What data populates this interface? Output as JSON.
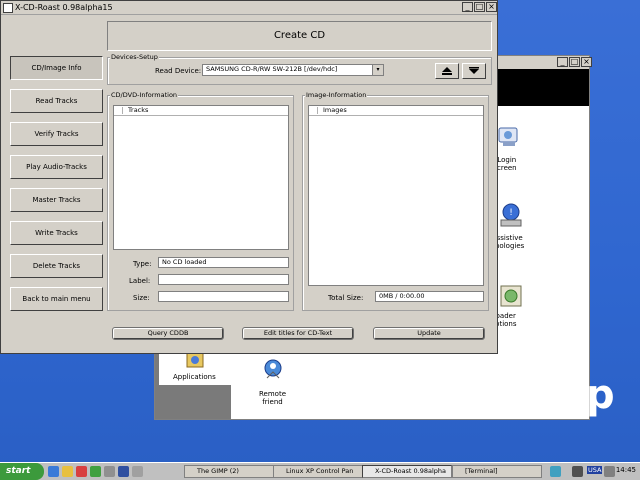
{
  "main_window": {
    "title": "X-CD-Roast 0.98alpha15",
    "header_title": "Create CD",
    "sidebar": [
      {
        "label": "CD/Image Info",
        "active": true
      },
      {
        "label": "Read Tracks",
        "active": false
      },
      {
        "label": "Verify Tracks",
        "active": false
      },
      {
        "label": "Play Audio-Tracks",
        "active": false
      },
      {
        "label": "Master Tracks",
        "active": false
      },
      {
        "label": "Write Tracks",
        "active": false
      },
      {
        "label": "Delete Tracks",
        "active": false
      },
      {
        "label": "Back to main menu",
        "active": false
      }
    ],
    "devices_setup": {
      "group_label": "Devices-Setup",
      "read_device_label": "Read Device:",
      "read_device_value": "SAMSUNG  CD-R/RW SW-212B  [/dev/hdc]"
    },
    "cd_info": {
      "group_label": "CD/DVD-Information",
      "list_header": "Tracks",
      "type_label": "Type:",
      "type_value": "No CD loaded",
      "label_label": "Label:",
      "label_value": "",
      "size_label": "Size:",
      "size_value": ""
    },
    "image_info": {
      "group_label": "Image-Information",
      "list_header": "Images",
      "total_size_label": "Total Size:",
      "total_size_value": "0MB / 0:00.00"
    },
    "buttons": {
      "query_cddb": "Query CDDB",
      "edit_titles": "Edit titles for CD-Text",
      "update": "Update"
    }
  },
  "background_window": {
    "icons": [
      {
        "label_lines": [
          "Login",
          "creen"
        ],
        "icon": "login-screen-icon"
      },
      {
        "label_lines": [
          "ssistive",
          "nologies"
        ],
        "icon": "assistive-technologies-icon"
      },
      {
        "label_lines": [
          "oader",
          "ptions"
        ],
        "icon": "loader-options-icon"
      },
      {
        "label_lines": [
          "Applications"
        ],
        "icon": "applications-icon"
      },
      {
        "label_lines": [
          "Remote",
          "friend"
        ],
        "icon": "remote-friend-icon"
      }
    ]
  },
  "wallpaper_text": "p",
  "taskbar": {
    "start_label": "start",
    "tasks": [
      {
        "label": "The GIMP (2)",
        "active": false
      },
      {
        "label": "Linux XP Control Pan",
        "active": false
      },
      {
        "label": "X-CD-Roast 0.98alpha",
        "active": true
      },
      {
        "label": "[Terminal]",
        "active": false
      }
    ],
    "keyboard_layout": "USA",
    "clock": "14:45"
  },
  "colors": {
    "desktop_blue": "#2f66cf",
    "window_grey": "#d4d0c8",
    "start_green": "#3c9a3c"
  }
}
